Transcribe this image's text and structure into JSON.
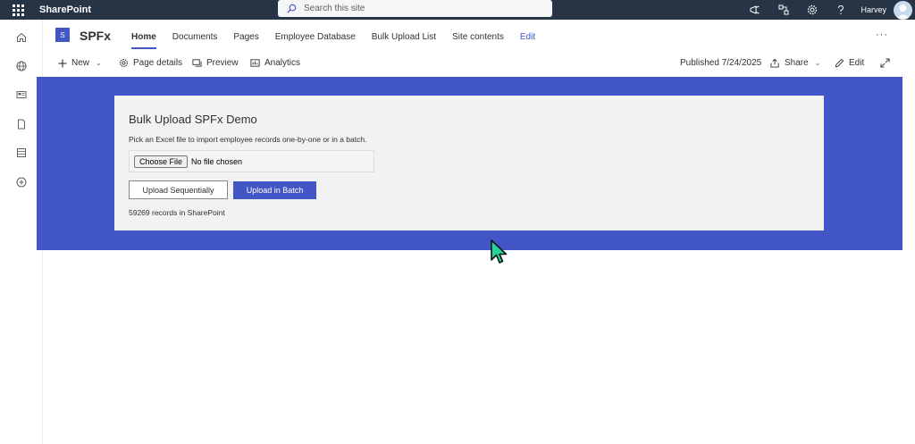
{
  "suitebar": {
    "app_name": "SharePoint",
    "search_placeholder": "Search this site",
    "user_name": "Harvey"
  },
  "site": {
    "logo_letter": "S",
    "title": "SPFx",
    "nav": [
      {
        "label": "Home",
        "active": true
      },
      {
        "label": "Documents"
      },
      {
        "label": "Pages"
      },
      {
        "label": "Employee Database"
      },
      {
        "label": "Bulk Upload List"
      },
      {
        "label": "Site contents"
      },
      {
        "label": "Edit"
      }
    ],
    "more": "···"
  },
  "commandbar": {
    "new": "New",
    "page_details": "Page details",
    "preview": "Preview",
    "analytics": "Analytics",
    "published": "Published 7/24/2025",
    "share": "Share",
    "edit": "Edit"
  },
  "webpart": {
    "title": "Bulk Upload SPFx Demo",
    "description": "Pick an Excel file to import employee records one-by-one or in a batch.",
    "choose_file": "Choose File",
    "no_file": "No file chosen",
    "upload_sequential": "Upload Sequentially",
    "upload_batch": "Upload in Batch",
    "records": "59269 records in SharePoint"
  },
  "colors": {
    "suitebar": "#263445",
    "accent": "#4256c6",
    "band": "#4356c7",
    "card": "#f2f2f2"
  }
}
